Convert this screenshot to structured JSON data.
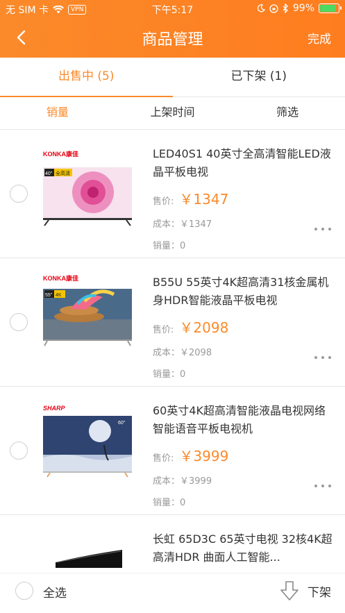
{
  "status_bar": {
    "carrier": "无 SIM 卡",
    "vpn": "VPN",
    "time": "下午5:17",
    "battery": "99%"
  },
  "nav": {
    "title": "商品管理",
    "done": "完成"
  },
  "tabs": [
    {
      "label": "出售中 (5)"
    },
    {
      "label": "已下架 (1)"
    }
  ],
  "sorts": [
    {
      "label": "销量"
    },
    {
      "label": "上架时间"
    },
    {
      "label": "筛选"
    }
  ],
  "items": [
    {
      "title": "LED40S1 40英寸全高清智能LED液晶平板电视",
      "price_label": "售价:",
      "price": "￥1347",
      "cost_label": "成本：",
      "cost": "￥1347",
      "sales_label": "销量：",
      "sales": "0",
      "brand": "KONKA康佳",
      "size_badge": "40\"",
      "res_badge": "全高清"
    },
    {
      "title": "B55U 55英寸4K超高清31核金属机身HDR智能液晶平板电视",
      "price_label": "售价:",
      "price": "￥2098",
      "cost_label": "成本：",
      "cost": "￥2098",
      "sales_label": "销量：",
      "sales": "0",
      "brand": "KONKA康佳",
      "size_badge": "55\"",
      "res_badge": "4K"
    },
    {
      "title": "60英寸4K超高清智能液晶电视网络智能语音平板电视机",
      "price_label": "售价:",
      "price": "￥3999",
      "cost_label": "成本：",
      "cost": "￥3999",
      "sales_label": "销量：",
      "sales": "0",
      "brand": "SHARP",
      "size_badge": "60\""
    },
    {
      "title": "长虹 65D3C 65英寸电视 32核4K超高清HDR 曲面人工智能..."
    }
  ],
  "footer": {
    "select_all": "全选",
    "off_shelf": "下架"
  },
  "colors": {
    "accent": "#fb8a2a",
    "divider": "#e6e6e6",
    "muted": "#999999"
  }
}
